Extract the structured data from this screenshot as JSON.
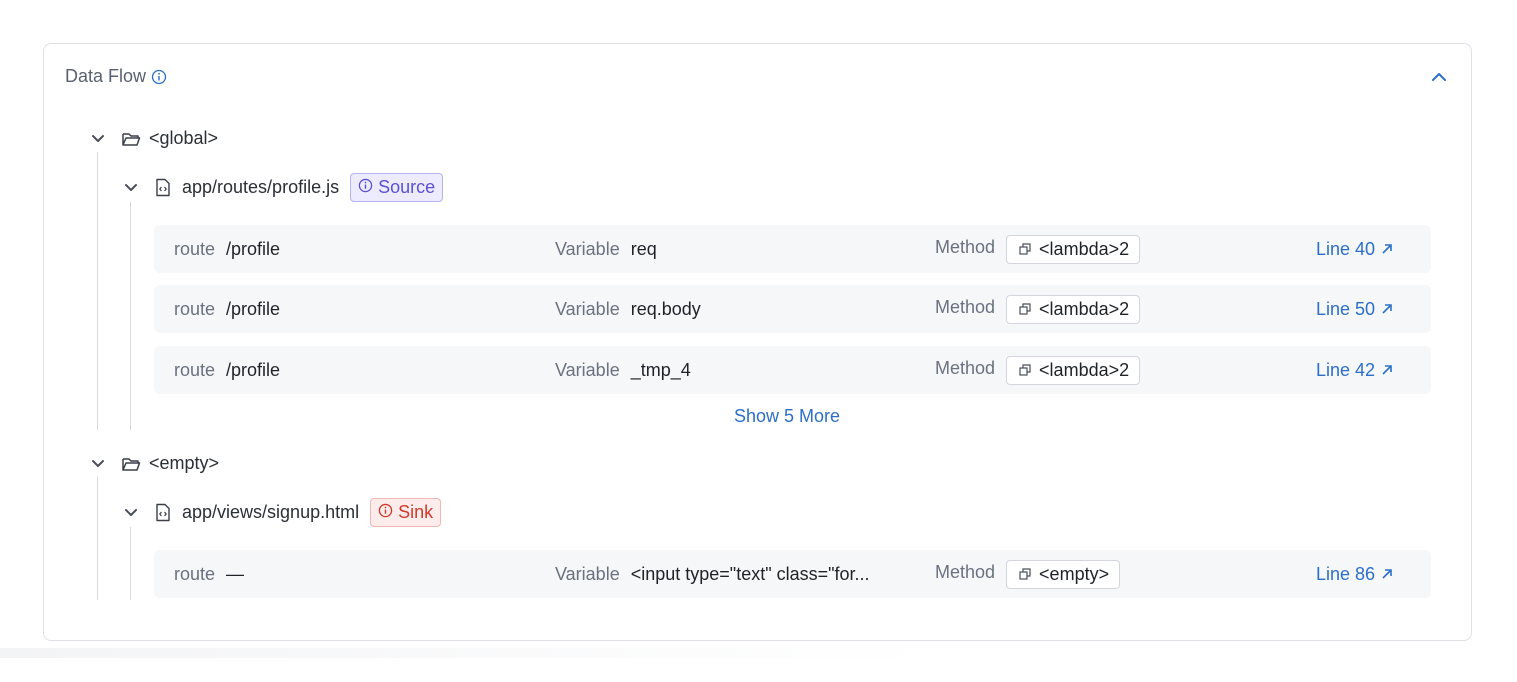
{
  "panel": {
    "title": "Data Flow"
  },
  "groups": [
    {
      "name": "<global>",
      "file": {
        "path": "app/routes/profile.js",
        "badge": "Source"
      },
      "rows": [
        {
          "route_key": "route",
          "route": "/profile",
          "variable_key": "Variable",
          "variable": "req",
          "method_key": "Method",
          "method": "<lambda>2",
          "line": "Line 40"
        },
        {
          "route_key": "route",
          "route": "/profile",
          "variable_key": "Variable",
          "variable": "req.body",
          "method_key": "Method",
          "method": "<lambda>2",
          "line": "Line 50"
        },
        {
          "route_key": "route",
          "route": "/profile",
          "variable_key": "Variable",
          "variable": "_tmp_4",
          "method_key": "Method",
          "method": "<lambda>2",
          "line": "Line 42"
        }
      ],
      "show_more": "Show 5 More"
    },
    {
      "name": "<empty>",
      "file": {
        "path": "app/views/signup.html",
        "badge": "Sink"
      },
      "rows": [
        {
          "route_key": "route",
          "route": "—",
          "variable_key": "Variable",
          "variable": "<input type=\"text\" class=\"for...",
          "method_key": "Method",
          "method": "<empty>",
          "line": "Line 86"
        }
      ]
    }
  ],
  "colors": {
    "link": "#2c6fc9",
    "source_badge": "#5a52d1",
    "sink_badge": "#d0392b"
  }
}
